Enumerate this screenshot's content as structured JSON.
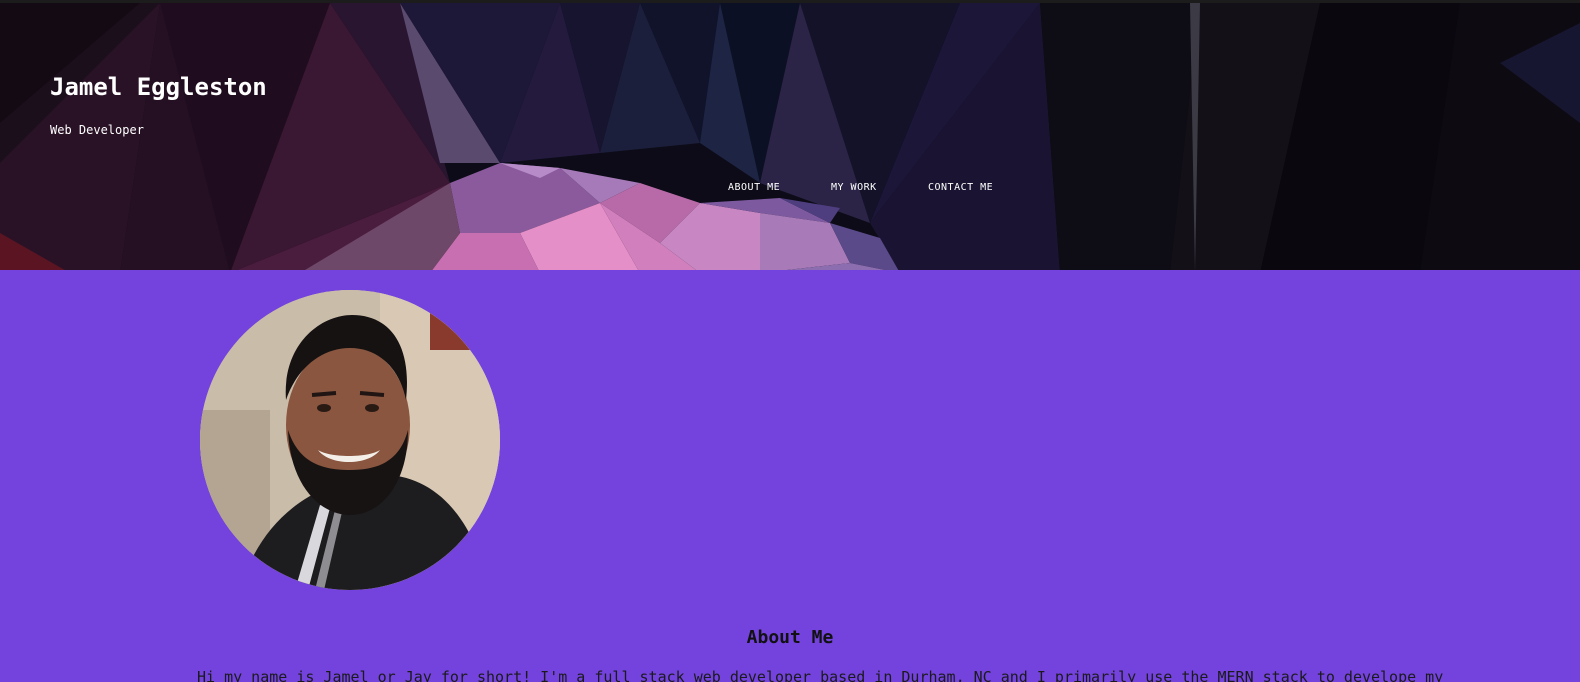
{
  "header": {
    "name": "Jamel Eggleston",
    "role": "Web Developer"
  },
  "nav": [
    {
      "label": "ABOUT ME"
    },
    {
      "label": "MY WORK"
    },
    {
      "label": "CONTACT ME"
    }
  ],
  "profile": {
    "photo_alt": "Jamel Eggleston profile photo"
  },
  "about": {
    "title": "About Me",
    "text": "Hi my name is Jamel or Jay for short! I'm a full stack web developer based in Durham, NC and I primarily use the MERN stack to develope my"
  },
  "colors": {
    "page_background": "#7443de",
    "header_background": "#0b0b16",
    "text_light": "#ffffff",
    "text_dark": "#111111"
  }
}
